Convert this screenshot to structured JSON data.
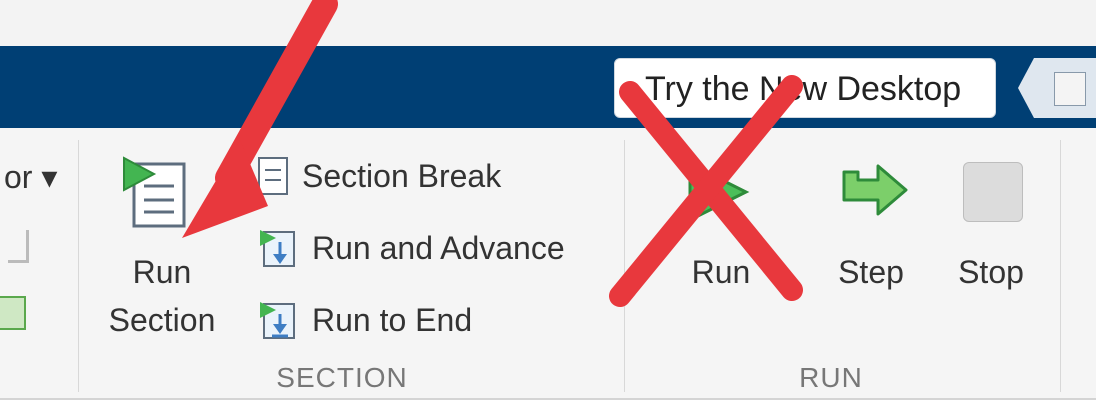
{
  "header": {
    "try_button_label": "Try the New Desktop"
  },
  "ribbon": {
    "left_partial_label": "or ▾",
    "section_group": {
      "run_section_line1": "Run",
      "run_section_line2": "Section",
      "section_break": "Section Break",
      "run_and_advance": "Run and Advance",
      "run_to_end": "Run to End",
      "group_label": "SECTION"
    },
    "run_group": {
      "run": "Run",
      "step": "Step",
      "stop": "Stop",
      "group_label": "RUN"
    }
  },
  "icons": [
    "run-section-icon",
    "section-break-icon",
    "run-and-advance-icon",
    "run-to-end-icon",
    "run-icon",
    "step-icon",
    "stop-icon",
    "red-arrow-annotation",
    "red-x-annotation",
    "desktop-icon"
  ],
  "colors": {
    "header_blue": "#003f74",
    "annotation_red": "#e8383d",
    "ribbon_bg": "#f5f5f5",
    "run_green": "#2fa84f"
  }
}
